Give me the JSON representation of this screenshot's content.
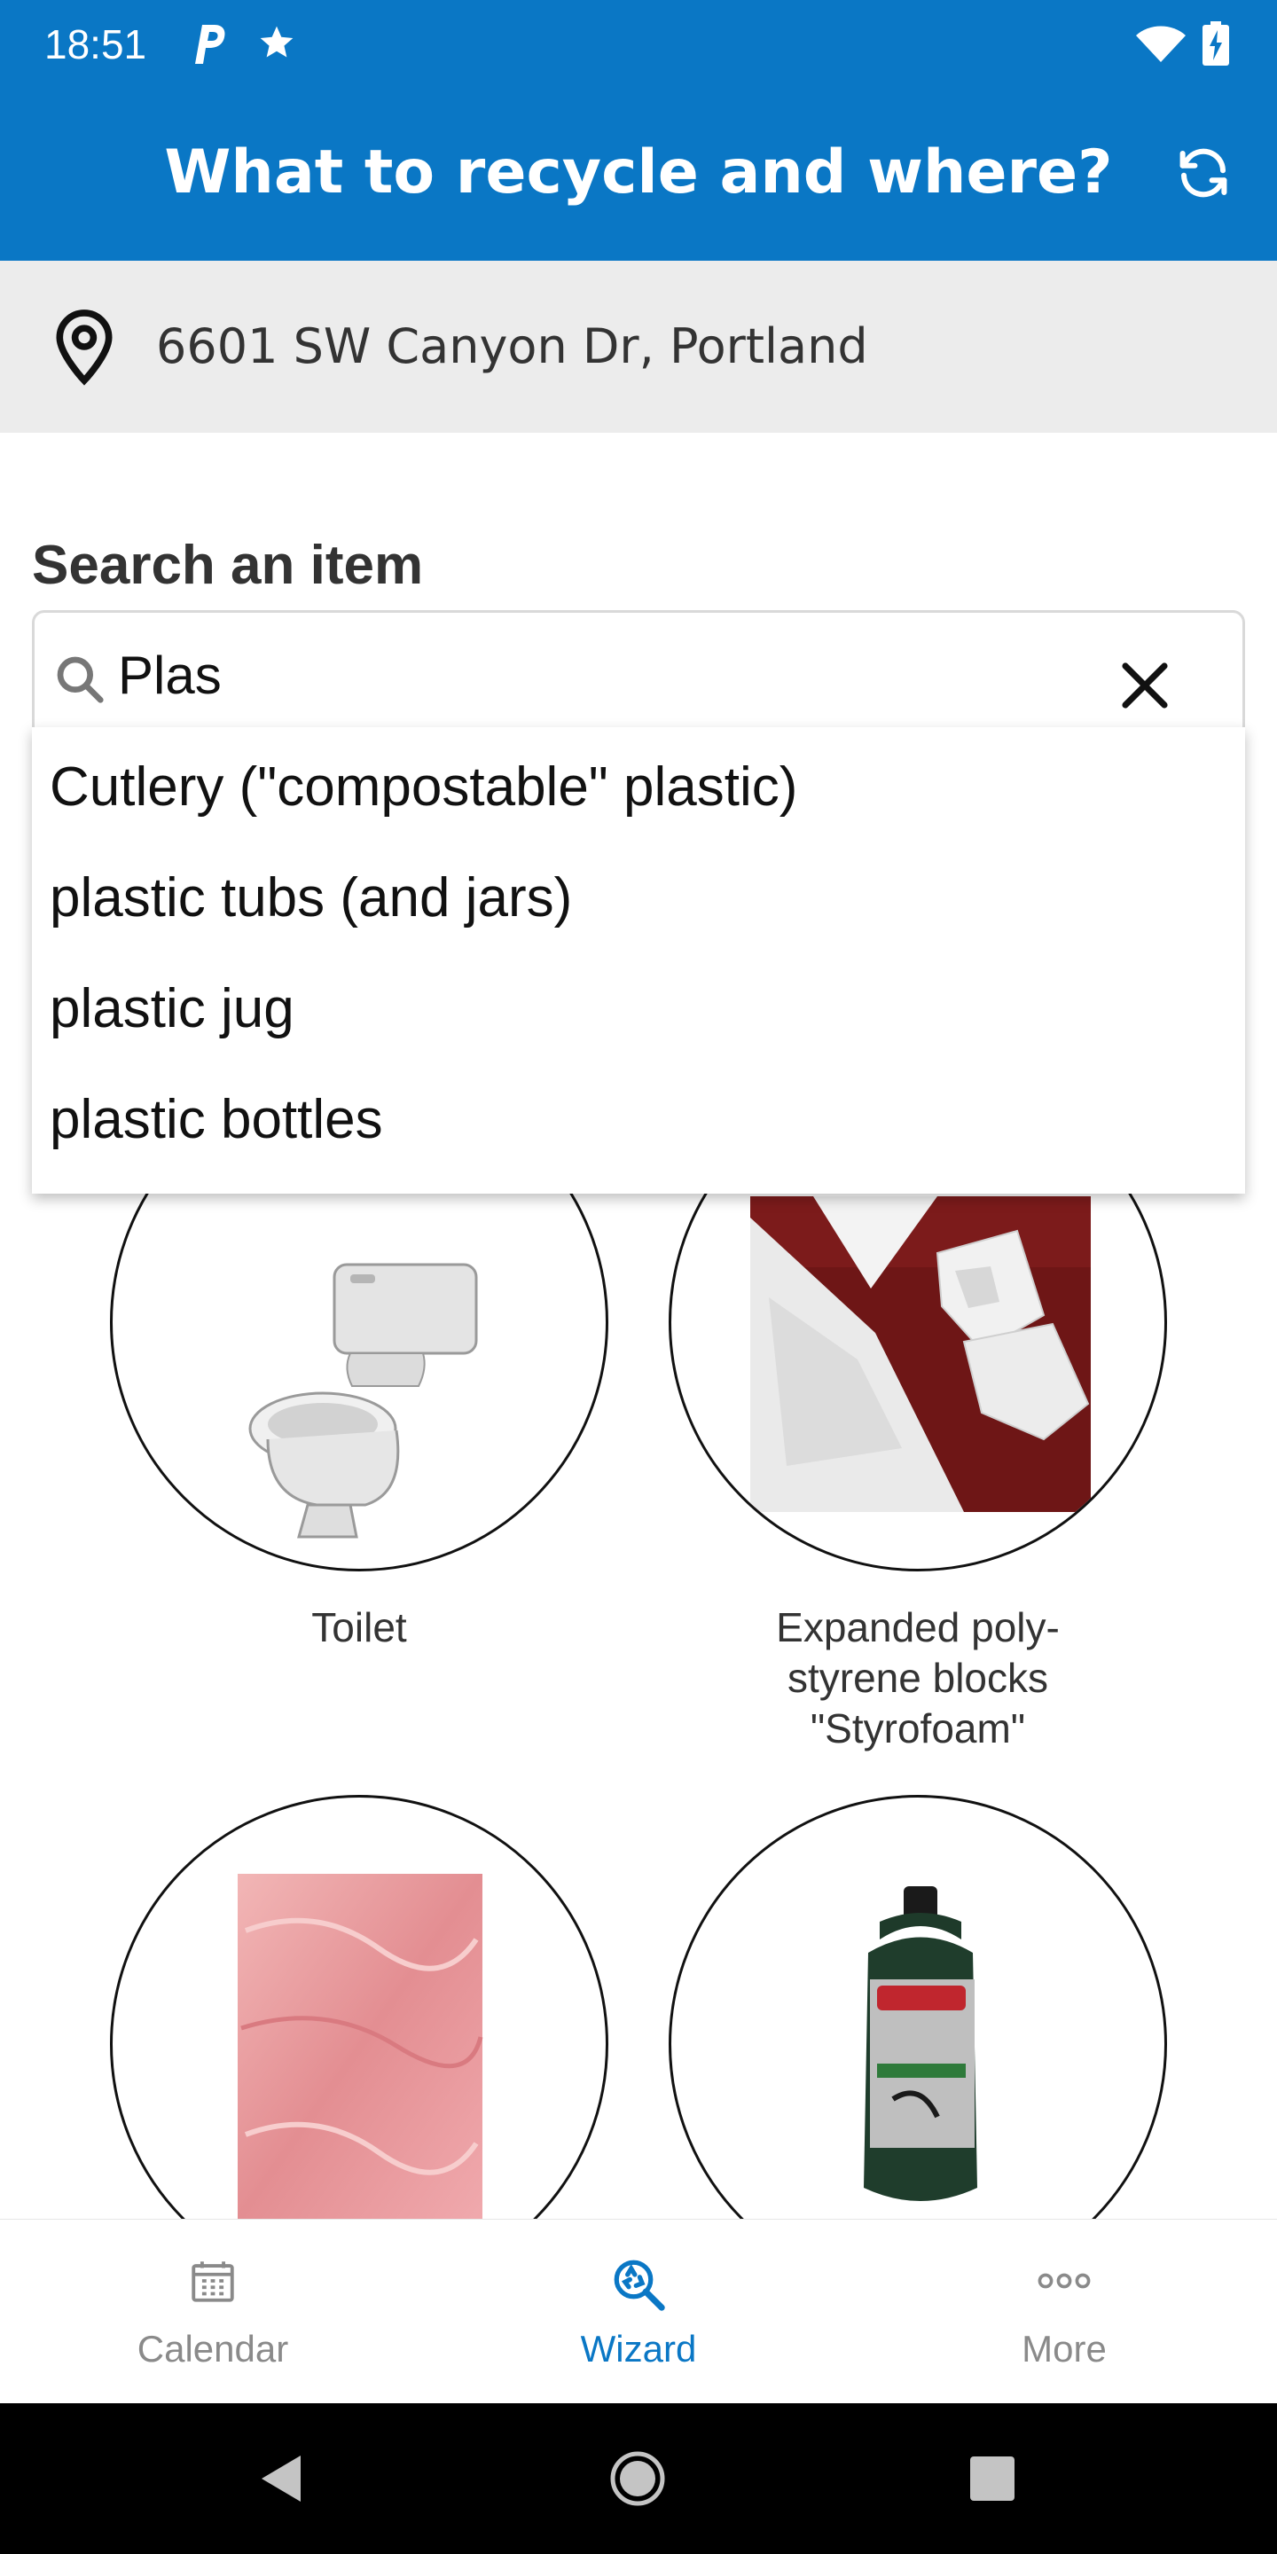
{
  "status_bar": {
    "time": "18:51",
    "icons": [
      "parking-icon",
      "star-icon",
      "wifi-icon",
      "battery-charging-icon"
    ]
  },
  "app_bar": {
    "title": "What to recycle and where?",
    "refresh_icon": "refresh-icon",
    "color": "#0a77c5"
  },
  "address": {
    "icon": "location-pin-icon",
    "text": "6601 SW Canyon Dr, Portland"
  },
  "search": {
    "label": "Search an item",
    "value": "Plas",
    "search_icon": "search-icon",
    "clear_icon": "close-icon"
  },
  "suggestions": [
    "Cutlery (\"compostable\" plastic)",
    "plastic tubs (and jars)",
    "plastic jug",
    "plastic bottles"
  ],
  "items": [
    {
      "label": "Toilet",
      "image": "toilet-image"
    },
    {
      "label_lines": [
        "Expanded poly-",
        "styrene blocks",
        "\"Styrofoam\""
      ],
      "image": "styrofoam-image"
    },
    {
      "label": "",
      "image": "insulation-image"
    },
    {
      "label": "",
      "image": "propane-cylinder-image"
    }
  ],
  "bottom_nav": {
    "items": [
      {
        "label": "Calendar",
        "icon": "calendar-icon",
        "active": false
      },
      {
        "label": "Wizard",
        "icon": "recycle-search-icon",
        "active": true
      },
      {
        "label": "More",
        "icon": "more-dots-icon",
        "active": false
      }
    ],
    "active_color": "#0a77c5",
    "inactive_color": "#8a8a8a"
  },
  "system_nav": {
    "icons": [
      "back-icon",
      "home-icon",
      "recents-icon"
    ]
  }
}
